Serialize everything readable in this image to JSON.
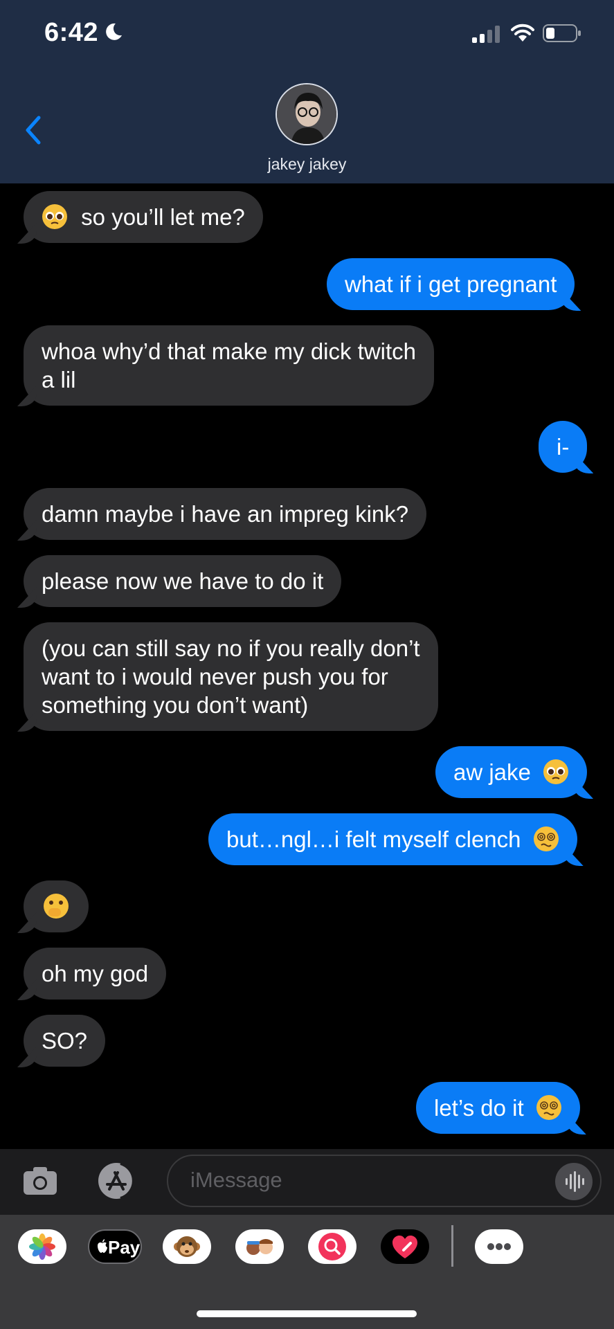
{
  "status_bar": {
    "time": "6:42"
  },
  "contact": {
    "name": "jakey jakey"
  },
  "messages": [
    {
      "dir": "in",
      "emoji": "pleading-face",
      "text": "so you’ll let me?"
    },
    {
      "dir": "out",
      "text": "what if i get pregnant"
    },
    {
      "dir": "in",
      "line1": "whoa why’d that make my dick twitch",
      "line2": "a lil"
    },
    {
      "dir": "out",
      "text": "i-"
    },
    {
      "dir": "in",
      "text": "damn maybe i have an impreg kink?"
    },
    {
      "dir": "in",
      "text": "please now we have to do it"
    },
    {
      "dir": "in",
      "line1": "(you can still say no if you really don’t",
      "line2": "want to i would never push you for",
      "line3": "something you don’t want)"
    },
    {
      "dir": "out",
      "text": "aw jake",
      "emoji": "pleading-face"
    },
    {
      "dir": "out",
      "text": "but…ngl…i felt myself clench",
      "emoji": "face-with-spiral-eyes"
    },
    {
      "dir": "in",
      "emoji": "face-with-hand-over-mouth"
    },
    {
      "dir": "in",
      "text": "oh my god"
    },
    {
      "dir": "in",
      "text": "SO?"
    },
    {
      "dir": "out",
      "text": "let’s do it",
      "emoji": "face-with-spiral-eyes"
    }
  ],
  "input": {
    "placeholder": "iMessage"
  },
  "app_drawer": {
    "apple_pay": "Pay"
  },
  "colors": {
    "incoming": "#2f2f31",
    "outgoing": "#0a7cf6",
    "header": "#1f2d45",
    "link": "#0a84ff"
  }
}
